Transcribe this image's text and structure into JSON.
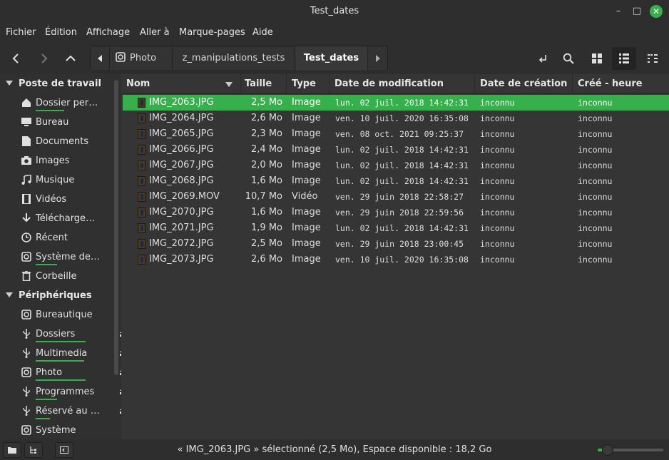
{
  "window": {
    "title": "Test_dates"
  },
  "menu": [
    "Fichier",
    "Édition",
    "Affichage",
    "Aller à",
    "Marque-pages",
    "Aide"
  ],
  "breadcrumbs": [
    "Photo",
    "z_manipulations_tests",
    "Test_dates"
  ],
  "sidebar": {
    "sections": [
      {
        "title": "Poste de travail",
        "items": [
          {
            "label": "Dossier per…",
            "icon": "home-icon"
          },
          {
            "label": "Bureau",
            "icon": "desktop-icon"
          },
          {
            "label": "Documents",
            "icon": "document-icon"
          },
          {
            "label": "Images",
            "icon": "camera-icon"
          },
          {
            "label": "Musique",
            "icon": "music-icon"
          },
          {
            "label": "Vidéos",
            "icon": "film-icon"
          },
          {
            "label": "Télécharge…",
            "icon": "download-icon"
          },
          {
            "label": "Récent",
            "icon": "clock-icon"
          },
          {
            "label": "Système de…",
            "icon": "drive-icon"
          },
          {
            "label": "Corbeille",
            "icon": "trash-icon"
          }
        ]
      },
      {
        "title": "Périphériques",
        "items": [
          {
            "label": "Bureautique",
            "icon": "drive-icon"
          },
          {
            "label": "Dossiers",
            "icon": "usb-icon",
            "eject": true
          },
          {
            "label": "Multimedia",
            "icon": "usb-icon",
            "eject": true
          },
          {
            "label": "Photo",
            "icon": "drive-icon",
            "eject": true
          },
          {
            "label": "Programmes",
            "icon": "usb-icon",
            "eject": true
          },
          {
            "label": "Réservé au …",
            "icon": "usb-icon",
            "eject": true
          },
          {
            "label": "Système",
            "icon": "drive-icon"
          }
        ]
      }
    ]
  },
  "columns": [
    "Nom",
    "Taille",
    "Type",
    "Date de modification",
    "Date de création",
    "Créé - heure"
  ],
  "files": [
    {
      "name": "IMG_2063.JPG",
      "size": "2,5 Mo",
      "type": "Image",
      "modified": "lun. 02 juil. 2018 14:42:31",
      "created": "inconnu",
      "created_time": "inconnu",
      "selected": true
    },
    {
      "name": "IMG_2064.JPG",
      "size": "2,6 Mo",
      "type": "Image",
      "modified": "ven. 10 juil. 2020 16:35:08",
      "created": "inconnu",
      "created_time": "inconnu"
    },
    {
      "name": "IMG_2065.JPG",
      "size": "2,3 Mo",
      "type": "Image",
      "modified": "ven. 08 oct. 2021 09:25:37",
      "created": "inconnu",
      "created_time": "inconnu"
    },
    {
      "name": "IMG_2066.JPG",
      "size": "2,4 Mo",
      "type": "Image",
      "modified": "lun. 02 juil. 2018 14:42:31",
      "created": "inconnu",
      "created_time": "inconnu"
    },
    {
      "name": "IMG_2067.JPG",
      "size": "2,0 Mo",
      "type": "Image",
      "modified": "lun. 02 juil. 2018 14:42:31",
      "created": "inconnu",
      "created_time": "inconnu"
    },
    {
      "name": "IMG_2068.JPG",
      "size": "1,6 Mo",
      "type": "Image",
      "modified": "lun. 02 juil. 2018 14:42:31",
      "created": "inconnu",
      "created_time": "inconnu"
    },
    {
      "name": "IMG_2069.MOV",
      "size": "10,7 Mo",
      "type": "Vidéo",
      "modified": "ven. 29 juin 2018 22:58:27",
      "created": "inconnu",
      "created_time": "inconnu"
    },
    {
      "name": "IMG_2070.JPG",
      "size": "1,6 Mo",
      "type": "Image",
      "modified": "ven. 29 juin 2018 22:59:56",
      "created": "inconnu",
      "created_time": "inconnu"
    },
    {
      "name": "IMG_2071.JPG",
      "size": "1,9 Mo",
      "type": "Image",
      "modified": "lun. 02 juil. 2018 14:42:31",
      "created": "inconnu",
      "created_time": "inconnu"
    },
    {
      "name": "IMG_2072.JPG",
      "size": "2,5 Mo",
      "type": "Image",
      "modified": "ven. 29 juin 2018 23:00:45",
      "created": "inconnu",
      "created_time": "inconnu"
    },
    {
      "name": "IMG_2073.JPG",
      "size": "2,6 Mo",
      "type": "Image",
      "modified": "ven. 10 juil. 2020 16:35:08",
      "created": "inconnu",
      "created_time": "inconnu"
    }
  ],
  "status": {
    "text": "« IMG_2063.JPG » sélectionné (2,5 Mo), Espace disponible : 18,2 Go",
    "zoom_fraction": 0.15
  },
  "colors": {
    "accent": "#35b04a",
    "background": "#353535",
    "sidebar": "#303030"
  }
}
